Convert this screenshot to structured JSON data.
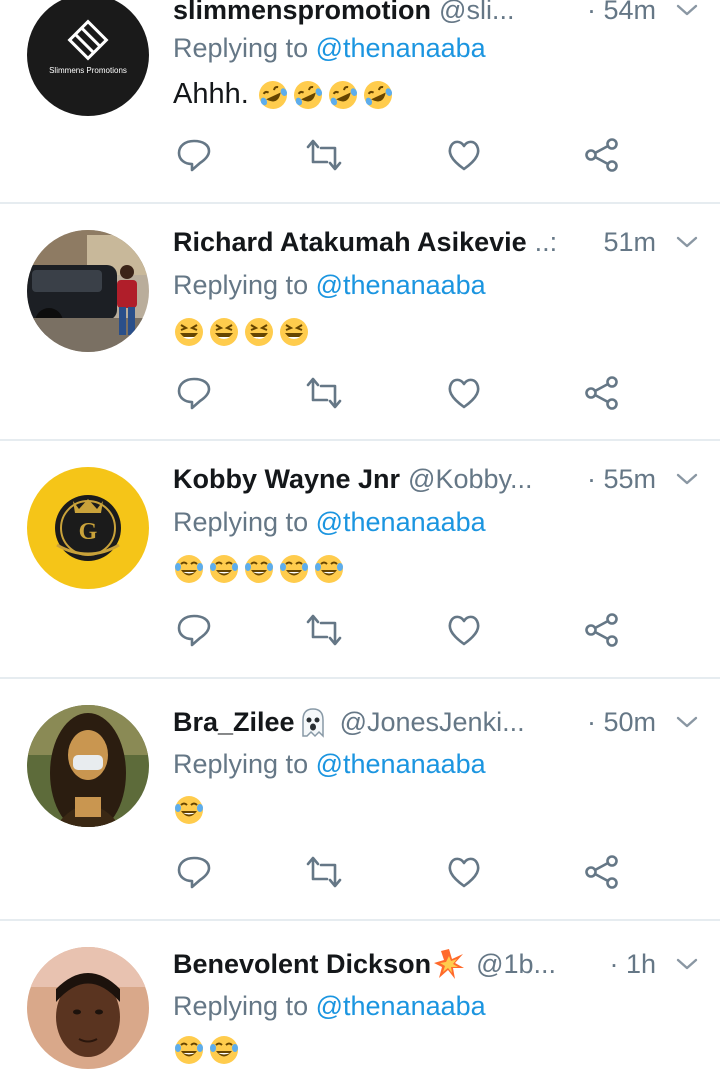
{
  "tweets": [
    {
      "name": "slimmenspromotion",
      "handle": "@sli...",
      "time": "· 54m",
      "reply_prefix": "Replying to",
      "reply_to": "@thenanaaba",
      "text": "Ahhh.",
      "emoji": [
        "rofl",
        "rofl",
        "rofl",
        "rofl"
      ],
      "avatar": "slimmens-logo",
      "avatar_text": "Slimmens Promotions"
    },
    {
      "name": "Richard Atakumah Asikevie",
      "handle": "..:",
      "time": "51m",
      "reply_prefix": "Replying to",
      "reply_to": "@thenanaaba",
      "text": "",
      "emoji": [
        "laughing",
        "laughing",
        "laughing",
        "laughing"
      ],
      "avatar": "photo-man-car"
    },
    {
      "name": "Kobby Wayne Jnr",
      "handle": "@Kobby...",
      "time": "· 55m",
      "reply_prefix": "Replying to",
      "reply_to": "@thenanaaba",
      "text": "",
      "emoji": [
        "joy",
        "joy",
        "joy",
        "joy",
        "joy"
      ],
      "avatar": "gold-emblem-logo"
    },
    {
      "name": "Bra_Zilee",
      "name_emoji": "ghost",
      "handle": "@JonesJenki...",
      "time": "· 50m",
      "reply_prefix": "Replying to",
      "reply_to": "@thenanaaba",
      "text": "",
      "emoji": [
        "joy"
      ],
      "avatar": "mona-lisa-mask"
    },
    {
      "name": "Benevolent Dickson",
      "name_emoji": "collision",
      "handle": "@1b...",
      "time": "· 1h",
      "reply_prefix": "Replying to",
      "reply_to": "@thenanaaba",
      "text": "",
      "emoji": [
        "joy",
        "joy"
      ],
      "avatar": "photo-man-portrait"
    }
  ],
  "icons": {
    "reply": "reply-icon",
    "retweet": "retweet-icon",
    "like": "heart-icon",
    "share": "share-icon",
    "more": "chevron-down-icon"
  },
  "colors": {
    "link": "#1b95e0",
    "secondary": "#657786",
    "divider": "#e6ecf0",
    "emoji": "#ffcc4d"
  }
}
